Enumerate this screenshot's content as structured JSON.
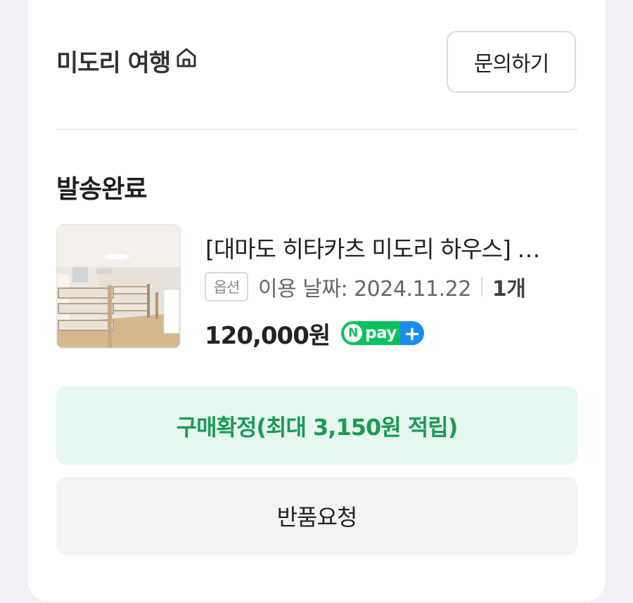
{
  "store": {
    "name": "미도리 여행",
    "icon": "home-icon"
  },
  "inquiry_button": "문의하기",
  "order": {
    "status": "발송완료",
    "product_title": "[대마도 히타카츠 미도리 하우스] …",
    "option_tag": "옵션",
    "use_date": "이용 날짜: 2024.11.22",
    "quantity": "1개",
    "price": "120,000원",
    "pay_badge": {
      "n": "N",
      "label": "pay",
      "plus": "+"
    }
  },
  "actions": {
    "confirm_label": "구매확정(최대 3,150원 적립)",
    "return_label": "반품요청"
  },
  "colors": {
    "accent_green": "#1c9a55",
    "confirm_bg": "#e5f7ee",
    "npay_green": "#08c25f",
    "npay_blue": "#1b8df0"
  }
}
